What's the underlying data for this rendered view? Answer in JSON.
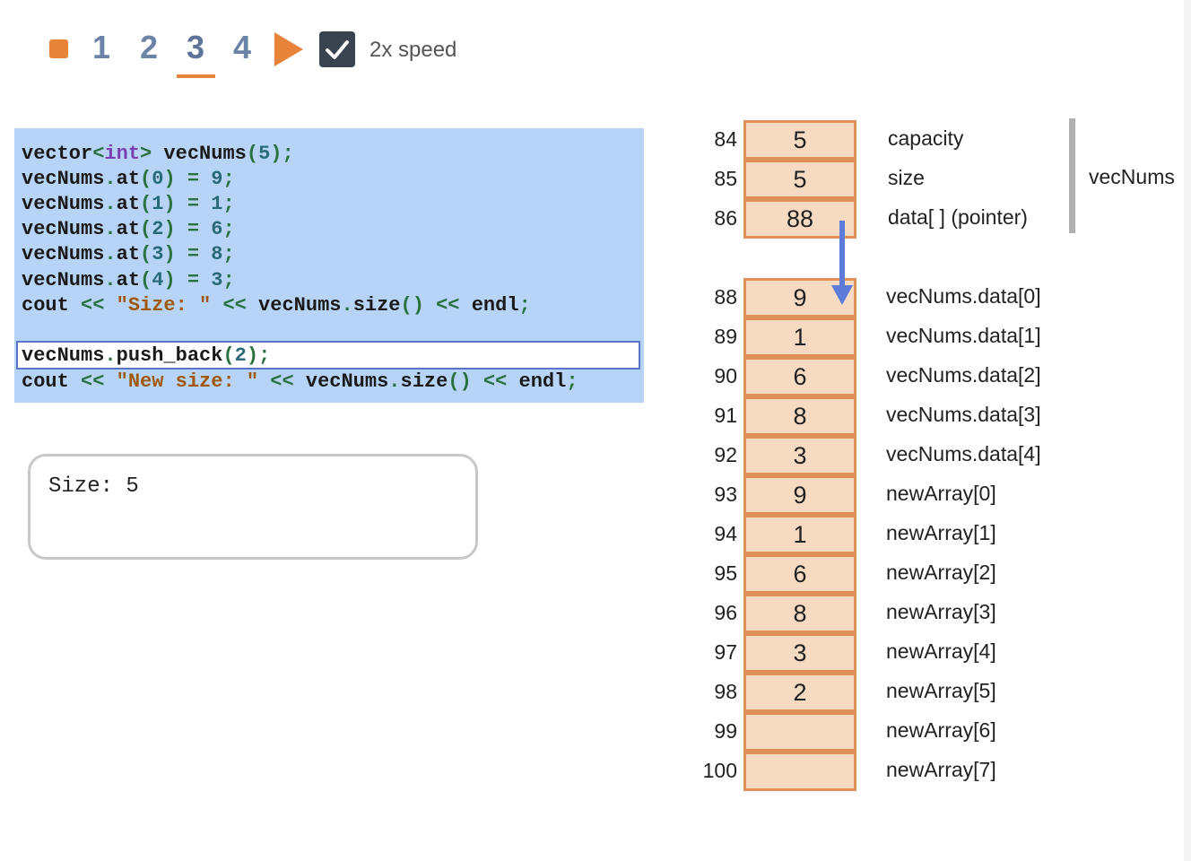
{
  "controls": {
    "steps": [
      "1",
      "2",
      "3",
      "4"
    ],
    "active_step": "3",
    "speed_label": "2x speed",
    "speed_checked": true
  },
  "code": {
    "lines": [
      "vector<int> vecNums(5);",
      "vecNums.at(0) = 9;",
      "vecNums.at(1) = 1;",
      "vecNums.at(2) = 6;",
      "vecNums.at(3) = 8;",
      "vecNums.at(4) = 3;",
      "cout << \"Size: \" << vecNums.size() << endl;",
      "vecNums.push_back(2);",
      "cout << \"New size: \" << vecNums.size() << endl;"
    ],
    "highlighted_line": "vecNums.push_back(2);"
  },
  "console": {
    "output": "Size: 5"
  },
  "memory": {
    "vector_name": "vecNums",
    "header": [
      {
        "address": "84",
        "value": "5",
        "label": "capacity"
      },
      {
        "address": "85",
        "value": "5",
        "label": "size"
      },
      {
        "address": "86",
        "value": "88",
        "label": "data[ ] (pointer)"
      }
    ],
    "cells": [
      {
        "address": "88",
        "value": "9",
        "label": "vecNums.data[0]"
      },
      {
        "address": "89",
        "value": "1",
        "label": "vecNums.data[1]"
      },
      {
        "address": "90",
        "value": "6",
        "label": "vecNums.data[2]"
      },
      {
        "address": "91",
        "value": "8",
        "label": "vecNums.data[3]"
      },
      {
        "address": "92",
        "value": "3",
        "label": "vecNums.data[4]"
      },
      {
        "address": "93",
        "value": "9",
        "label": "newArray[0]"
      },
      {
        "address": "94",
        "value": "1",
        "label": "newArray[1]"
      },
      {
        "address": "95",
        "value": "6",
        "label": "newArray[2]"
      },
      {
        "address": "96",
        "value": "8",
        "label": "newArray[3]"
      },
      {
        "address": "97",
        "value": "3",
        "label": "newArray[4]"
      },
      {
        "address": "98",
        "value": "2",
        "label": "newArray[5]"
      },
      {
        "address": "99",
        "value": "",
        "label": "newArray[6]"
      },
      {
        "address": "100",
        "value": "",
        "label": "newArray[7]"
      }
    ]
  },
  "colors": {
    "accent_orange": "#e8843a",
    "code_bg": "#b7d4f7",
    "cell_fill": "#f6dac2",
    "cell_border": "#e0915a",
    "pointer_arrow": "#5d7bd8"
  }
}
